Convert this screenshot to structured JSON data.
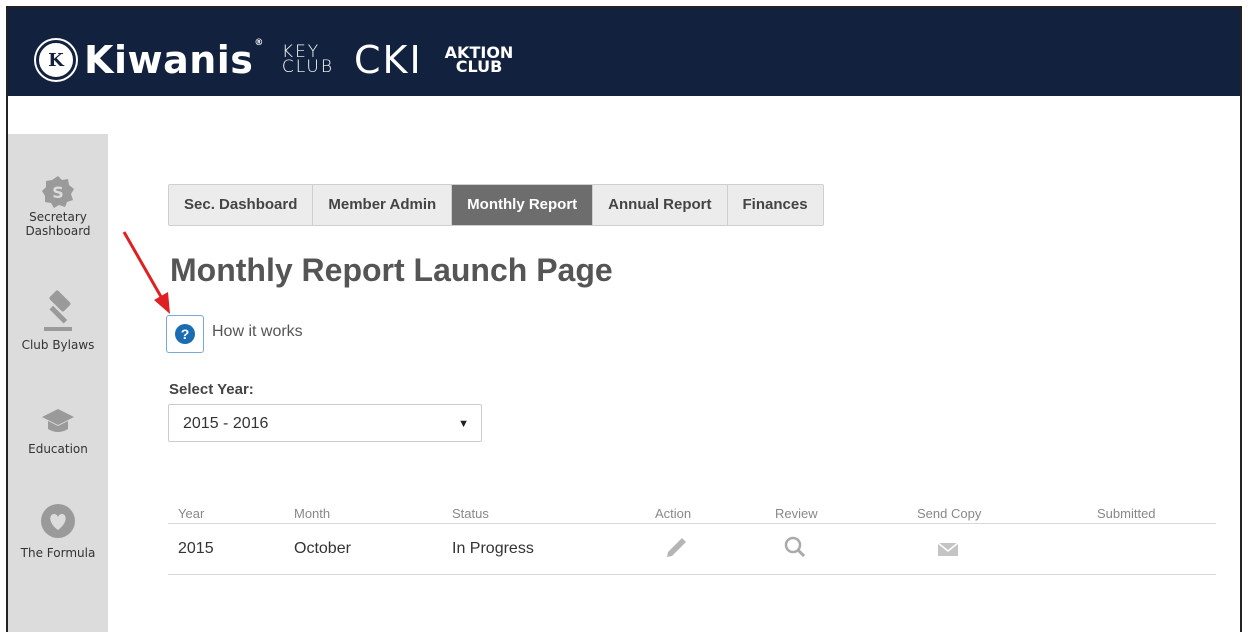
{
  "header": {
    "brand_kiwanis": "Kiwanis",
    "brand_seal": "K",
    "brand_key_line1": "KEY",
    "brand_key_line2": "CLUB",
    "brand_cki": "CKI",
    "brand_aktion_line1": "AKTION",
    "brand_aktion_line2": "CLUB",
    "background": "#12213d"
  },
  "sidebar": {
    "items": [
      {
        "label_line1": "Secretary",
        "label_line2": "Dashboard",
        "icon": "secretary-badge-icon"
      },
      {
        "label_line1": "Club Bylaws",
        "label_line2": "",
        "icon": "gavel-icon"
      },
      {
        "label_line1": "Education",
        "label_line2": "",
        "icon": "graduation-cap-icon"
      },
      {
        "label_line1": "The Formula",
        "label_line2": "",
        "icon": "heart-icon"
      }
    ]
  },
  "tabs": [
    {
      "label": "Sec. Dashboard",
      "active": false
    },
    {
      "label": "Member Admin",
      "active": false
    },
    {
      "label": "Monthly Report",
      "active": true
    },
    {
      "label": "Annual Report",
      "active": false
    },
    {
      "label": "Finances",
      "active": false
    }
  ],
  "page": {
    "title": "Monthly Report Launch Page",
    "help_icon": "?",
    "help_text": "How it works",
    "select_year_label": "Select Year:",
    "selected_year": "2015 - 2016"
  },
  "table": {
    "headers": [
      "Year",
      "Month",
      "Status",
      "Action",
      "Review",
      "Send Copy",
      "Submitted"
    ],
    "rows": [
      {
        "year": "2015",
        "month": "October",
        "status": "In Progress",
        "action_icon": "pencil-icon",
        "review_icon": "magnifier-icon",
        "send_icon": "envelope-icon",
        "submitted": ""
      }
    ]
  },
  "colors": {
    "active_tab": "#6d6d6d",
    "help_icon": "#1a6db3",
    "annotation_arrow": "#e02020"
  }
}
